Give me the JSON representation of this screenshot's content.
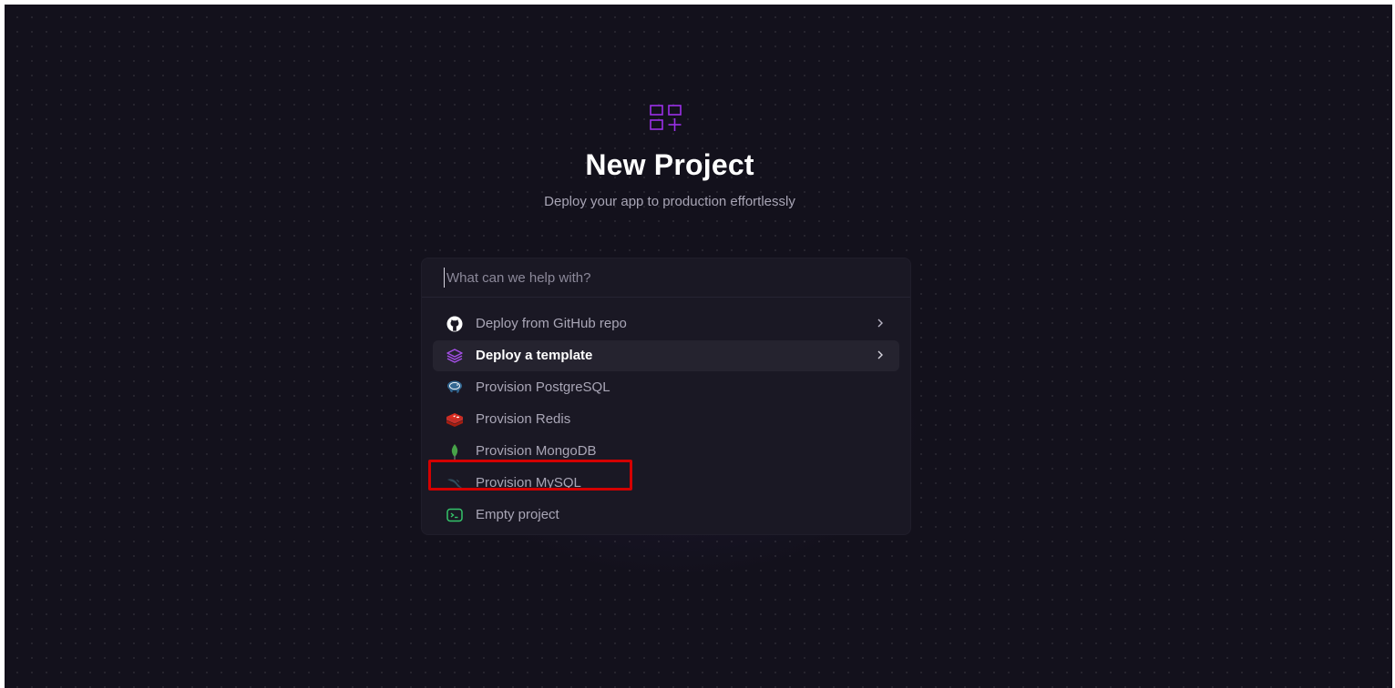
{
  "header": {
    "title": "New Project",
    "subtitle": "Deploy your app to production effortlessly",
    "icon": "grid-plus-icon"
  },
  "search": {
    "placeholder": "What can we help with?",
    "value": ""
  },
  "menu": {
    "items": [
      {
        "label": "Deploy from GitHub repo",
        "icon": "github-icon",
        "has_chevron": true
      },
      {
        "label": "Deploy a template",
        "icon": "layers-icon",
        "has_chevron": true,
        "active": true
      },
      {
        "label": "Provision PostgreSQL",
        "icon": "postgresql-icon"
      },
      {
        "label": "Provision Redis",
        "icon": "redis-icon"
      },
      {
        "label": "Provision MongoDB",
        "icon": "mongodb-icon"
      },
      {
        "label": "Provision MySQL",
        "icon": "mysql-icon",
        "highlighted": true
      },
      {
        "label": "Empty project",
        "icon": "terminal-icon"
      }
    ]
  },
  "colors": {
    "background": "#13111c",
    "panel": "#1a1824",
    "accent": "#8f2ce0",
    "highlight": "#d40000"
  }
}
